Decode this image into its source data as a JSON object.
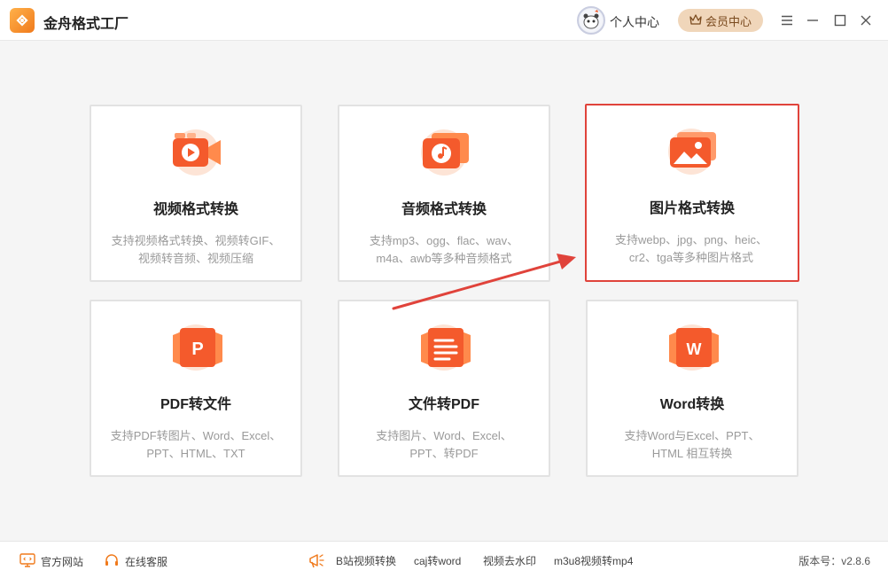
{
  "app": {
    "title": "金舟格式工厂"
  },
  "header": {
    "personal_center": "个人中心",
    "vip_center": "会员中心"
  },
  "cards": [
    {
      "title": "视频格式转换",
      "desc_line1": "支持视频格式转换、视频转GIF、",
      "desc_line2": "视频转音频、视频压缩",
      "icon": "video-icon"
    },
    {
      "title": "音频格式转换",
      "desc_line1": "支持mp3、ogg、flac、wav、",
      "desc_line2": "m4a、awb等多种音频格式",
      "icon": "music-icon"
    },
    {
      "title": "图片格式转换",
      "desc_line1": "支持webp、jpg、png、heic、",
      "desc_line2": "cr2、tga等多种图片格式",
      "icon": "image-icon",
      "selected": true
    },
    {
      "title": "PDF转文件",
      "desc_line1": "支持PDF转图片、Word、Excel、",
      "desc_line2": "PPT、HTML、TXT",
      "icon": "pdf-icon"
    },
    {
      "title": "文件转PDF",
      "desc_line1": "支持图片、Word、Excel、",
      "desc_line2": "PPT、转PDF",
      "icon": "document-icon"
    },
    {
      "title": "Word转换",
      "desc_line1": "支持Word与Excel、PPT、",
      "desc_line2": "HTML 相互转换",
      "icon": "word-icon"
    }
  ],
  "footer": {
    "official_site": "官方网站",
    "online_service": "在线客服",
    "links": [
      "B站视频转换",
      "caj转word",
      "视频去水印",
      "m3u8视频转mp4"
    ],
    "version": "版本号：v2.8.6"
  },
  "colors": {
    "accent": "#f05a2a",
    "highlight_border": "#e0433b",
    "vip_bg": "#f0d6ba",
    "icon_light": "#fcd9c7",
    "icon_gradient_start": "#ff8a4c",
    "icon_gradient_end": "#f04a24"
  }
}
